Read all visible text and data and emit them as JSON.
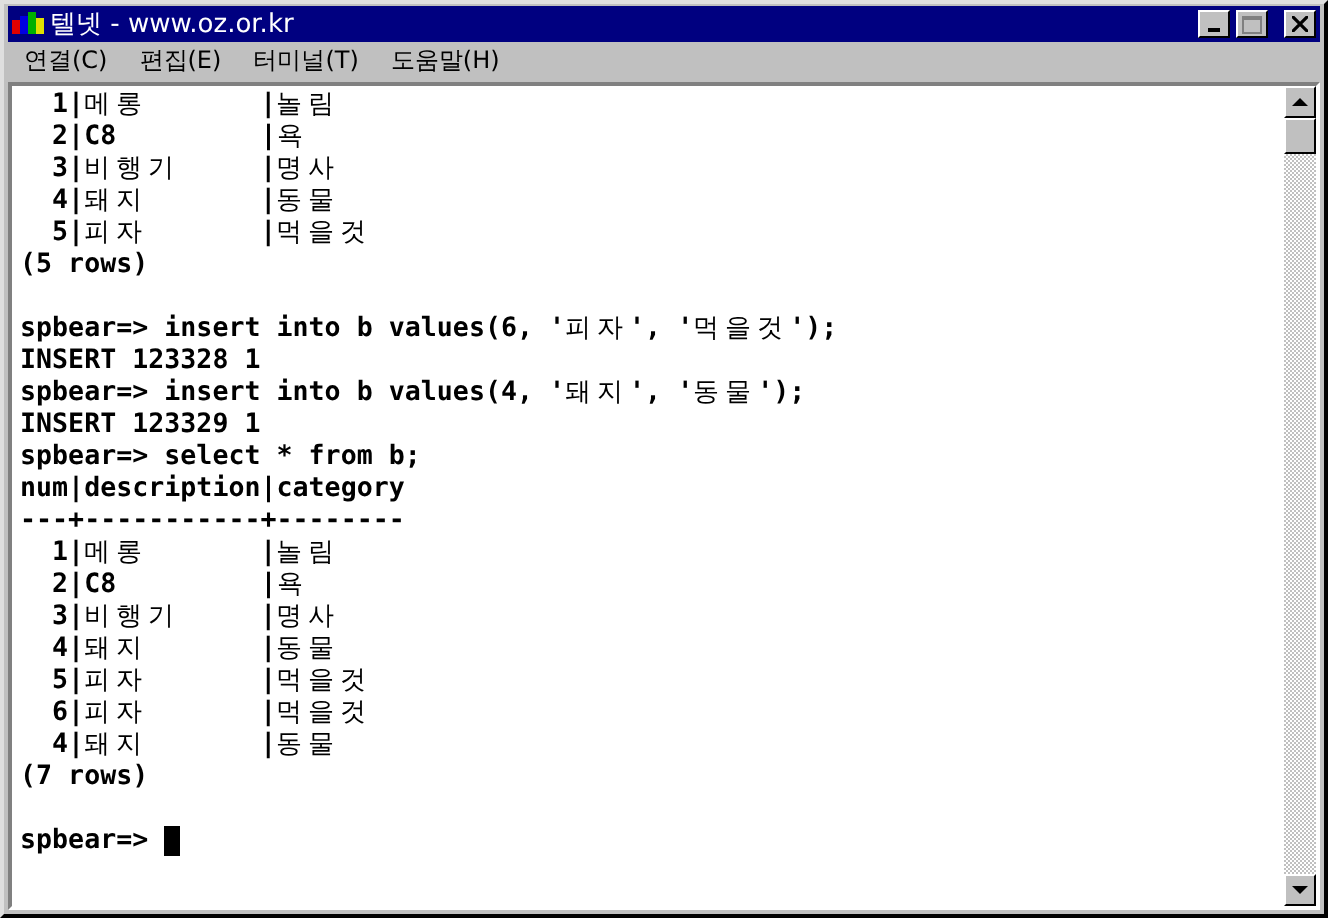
{
  "window": {
    "title": "텔넷 - www.oz.or.kr"
  },
  "menu": [
    {
      "label": "연결(C)"
    },
    {
      "label": "편집(E)"
    },
    {
      "label": "터미널(T)"
    },
    {
      "label": "도움말(H)"
    }
  ],
  "terminal": {
    "lines": [
      {
        "kind": "text",
        "text": "  1|메롱       |놀림"
      },
      {
        "kind": "text",
        "text": "  2|C8         |욕"
      },
      {
        "kind": "text",
        "text": "  3|비행기     |명사"
      },
      {
        "kind": "text",
        "text": "  4|돼지       |동물"
      },
      {
        "kind": "text",
        "text": "  5|피자       |먹을것"
      },
      {
        "kind": "text",
        "text": "(5 rows)"
      },
      {
        "kind": "blank"
      },
      {
        "kind": "text",
        "text": "spbear=> insert into b values(6, '피자', '먹을것');"
      },
      {
        "kind": "text",
        "text": "INSERT 123328 1"
      },
      {
        "kind": "text",
        "text": "spbear=> insert into b values(4, '돼지', '동물');"
      },
      {
        "kind": "text",
        "text": "INSERT 123329 1"
      },
      {
        "kind": "text",
        "text": "spbear=> select * from b;"
      },
      {
        "kind": "text",
        "text": "num|description|category"
      },
      {
        "kind": "text",
        "text": "---+-----------+--------"
      },
      {
        "kind": "text",
        "text": "  1|메롱       |놀림"
      },
      {
        "kind": "text",
        "text": "  2|C8         |욕"
      },
      {
        "kind": "text",
        "text": "  3|비행기     |명사"
      },
      {
        "kind": "text",
        "text": "  4|돼지       |동물"
      },
      {
        "kind": "text",
        "text": "  5|피자       |먹을것"
      },
      {
        "kind": "text",
        "text": "  6|피자       |먹을것"
      },
      {
        "kind": "text",
        "text": "  4|돼지       |동물"
      },
      {
        "kind": "text",
        "text": "(7 rows)"
      },
      {
        "kind": "blank"
      },
      {
        "kind": "text",
        "text": "spbear=> "
      }
    ],
    "cursor": true
  }
}
